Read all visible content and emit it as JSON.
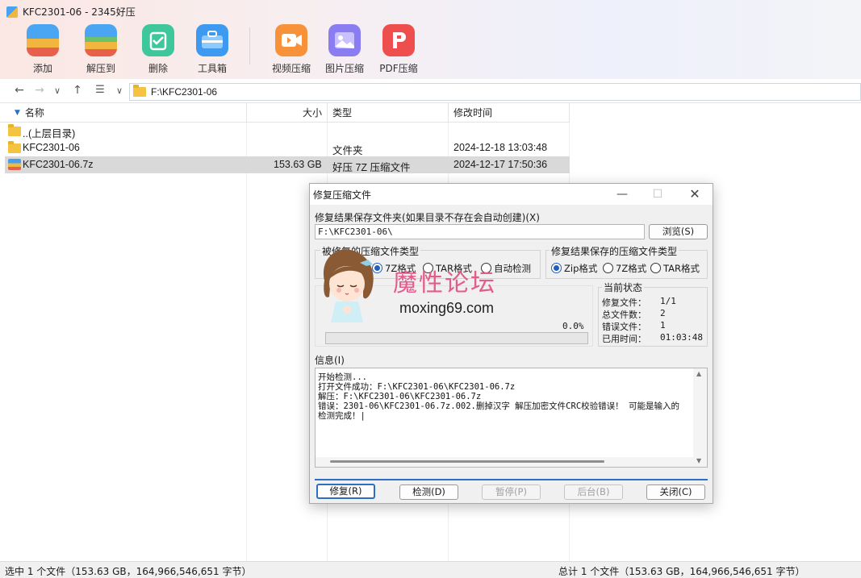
{
  "window": {
    "title": "KFC2301-06 - 2345好压"
  },
  "toolbar": {
    "add": "添加",
    "extract": "解压到",
    "delete": "删除",
    "tools": "工具箱",
    "video_compress": "视频压缩",
    "image_compress": "图片压缩",
    "pdf_compress": "PDF压缩"
  },
  "nav": {
    "address": "F:\\KFC2301-06"
  },
  "columns": {
    "name": "名称",
    "size": "大小",
    "type": "类型",
    "modified": "修改时间"
  },
  "files": [
    {
      "name": "..(上层目录)",
      "size": "",
      "type": "",
      "modified": ""
    },
    {
      "name": "KFC2301-06",
      "size": "",
      "type": "文件夹",
      "modified": "2024-12-18 13:03:48"
    },
    {
      "name": "KFC2301-06.7z",
      "size": "153.63 GB",
      "type": "好压 7Z 压缩文件",
      "modified": "2024-12-17 17:50:36"
    }
  ],
  "status": {
    "left": "选中 1 个文件（153.63 GB，164,966,546,651 字节）",
    "right": "总计 1 个文件（153.63 GB，164,966,546,651 字节）"
  },
  "dialog": {
    "title": "修复压缩文件",
    "folder_label": "修复结果保存文件夹(如果目录不存在会自动创建)(X)",
    "folder_value": "F:\\KFC2301-06\\",
    "browse": "浏览(S)",
    "src_group": "被修复的压缩文件类型",
    "src_options": [
      "7Z格式",
      "TAR格式",
      "自动检测"
    ],
    "dst_group": "修复结果保存的压缩文件类型",
    "dst_options": [
      "Zip格式",
      "7Z格式",
      "TAR格式"
    ],
    "percent": "0.0%",
    "progress": 0,
    "state_group": "当前状态",
    "state": [
      {
        "label": "修复文件：",
        "value": "1/1"
      },
      {
        "label": "总文件数：",
        "value": "2"
      },
      {
        "label": "错误文件：",
        "value": "1"
      },
      {
        "label": "已用时间：",
        "value": "01:03:48"
      }
    ],
    "info_label": "信息(I)",
    "info_lines": [
      "开始检测...",
      "打开文件成功：F:\\KFC2301-06\\KFC2301-06.7z",
      "解压：F:\\KFC2301-06\\KFC2301-06.7z",
      "错误：2301-06\\KFC2301-06.7z.002.删掉汉字 解压加密文件CRC校验错误！ 可能是输入的",
      "检测完成！|"
    ],
    "buttons": {
      "repair": "修复(R)",
      "check": "检测(D)",
      "pause": "暂停(P)",
      "background": "后台(B)",
      "close": "关闭(C)"
    }
  },
  "watermark": {
    "title": "魔性论坛",
    "url": "moxing69.com"
  }
}
